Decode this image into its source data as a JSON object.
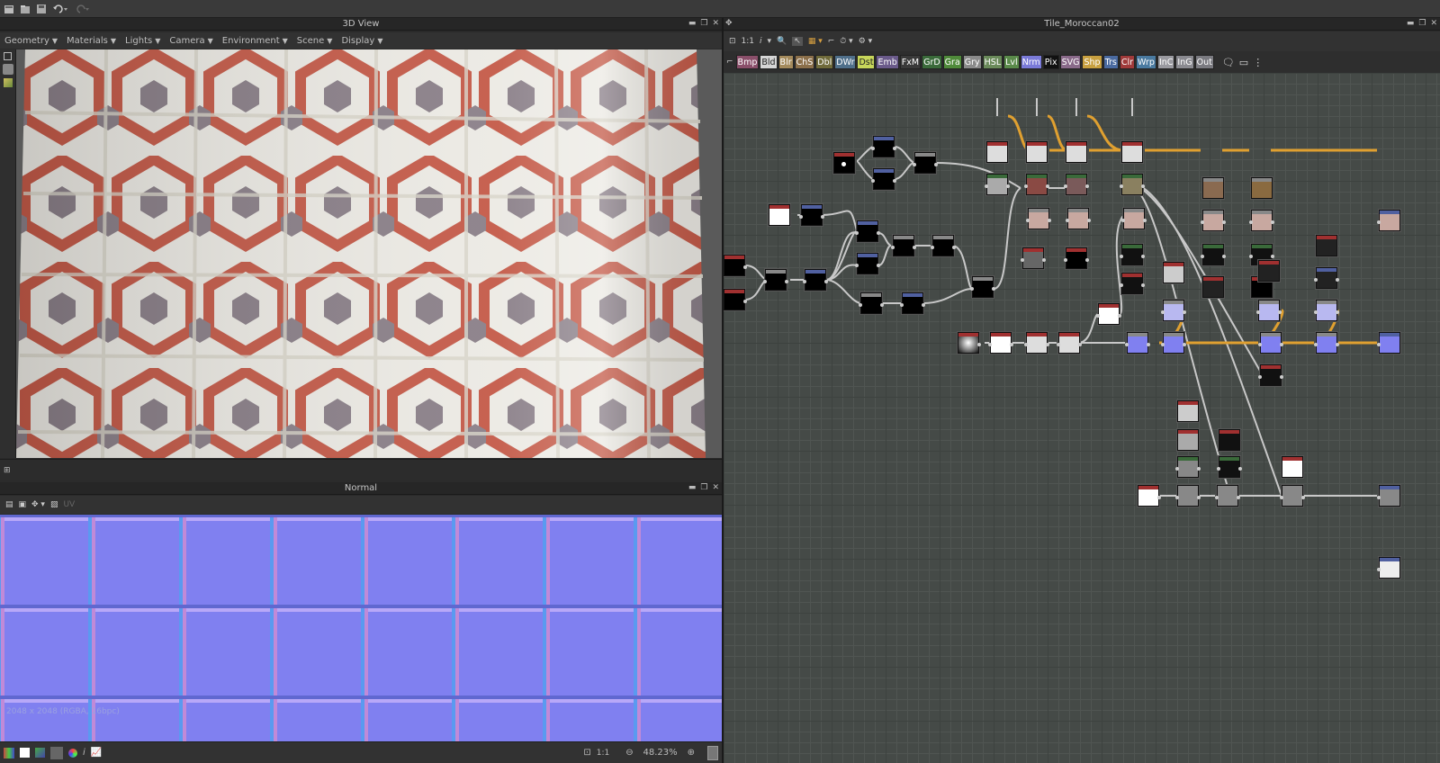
{
  "toolbar": {
    "icons": [
      "new-file-icon",
      "open-folder-icon",
      "save-icon",
      "undo-icon",
      "redo-icon"
    ]
  },
  "view3d": {
    "title": "3D View",
    "menus": [
      "Geometry",
      "Materials",
      "Lights",
      "Camera",
      "Environment",
      "Scene",
      "Display"
    ]
  },
  "normal": {
    "title": "Normal",
    "uv_label": "UV",
    "info": "2048 x 2048 (RGBA, 16bpc)",
    "zoom_ratio": "1:1",
    "zoom": "48.23%"
  },
  "graph": {
    "title": "Tile_Moroccan02",
    "zoom_ratio": "1:1",
    "info_label": "i",
    "library": [
      {
        "label": "Bmp",
        "color": "#8a4f6a"
      },
      {
        "label": "Bld",
        "color": "#d6d6d6",
        "dark": true
      },
      {
        "label": "Blr",
        "color": "#a48a5c"
      },
      {
        "label": "ChS",
        "color": "#8b6f4a"
      },
      {
        "label": "Dbl",
        "color": "#6f6a3a"
      },
      {
        "label": "DWr",
        "color": "#4f6f8a"
      },
      {
        "label": "Dst",
        "color": "#c7d65a",
        "dark": true
      },
      {
        "label": "Emb",
        "color": "#6a5a8a"
      },
      {
        "label": "FxM",
        "color": "#3a3a3a"
      },
      {
        "label": "GrD",
        "color": "#3a6a3a"
      },
      {
        "label": "Gra",
        "color": "#4f8a3a"
      },
      {
        "label": "Gry",
        "color": "#8a8a8a"
      },
      {
        "label": "HSL",
        "color": "#6a8a5a"
      },
      {
        "label": "Lvl",
        "color": "#5a8a4a"
      },
      {
        "label": "Nrm",
        "color": "#7a7ad8"
      },
      {
        "label": "Pix",
        "color": "#111111"
      },
      {
        "label": "SVG",
        "color": "#8a6a8a"
      },
      {
        "label": "Shp",
        "color": "#c8a040"
      },
      {
        "label": "Trs",
        "color": "#4a6aa0"
      },
      {
        "label": "Clr",
        "color": "#a03a3a"
      },
      {
        "label": "Wrp",
        "color": "#4a7aa0"
      },
      {
        "label": "InC",
        "color": "#9a9aa0"
      },
      {
        "label": "InG",
        "color": "#8a8a90"
      },
      {
        "label": "Out",
        "color": "#7a7a80"
      }
    ]
  }
}
